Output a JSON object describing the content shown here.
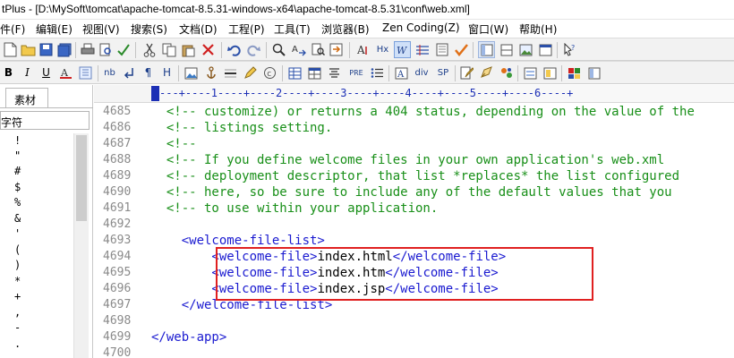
{
  "window": {
    "title": "tPlus - [D:\\MySoft\\tomcat\\apache-tomcat-8.5.31-windows-x64\\apache-tomcat-8.5.31\\conf\\web.xml]"
  },
  "menu": [
    {
      "label": "件(F)"
    },
    {
      "label": "编辑(E)"
    },
    {
      "label": "视图(V)"
    },
    {
      "label": "搜索(S)"
    },
    {
      "label": "文档(D)"
    },
    {
      "label": "工程(P)"
    },
    {
      "label": "工具(T)"
    },
    {
      "label": "浏览器(B)"
    },
    {
      "label": "Zen Coding(Z)"
    },
    {
      "label": "窗口(W)"
    },
    {
      "label": "帮助(H)"
    }
  ],
  "toolbar2_text": {
    "bold": "B",
    "italic": "I",
    "underline": "U",
    "nb": "nb",
    "pilcrow": "¶",
    "h_text": "H",
    "pre": "PRE",
    "div": "div",
    "sp": "SP",
    "hx": "Hx"
  },
  "left_panel": {
    "tab_label": "素材",
    "select_value": "字符",
    "characters": [
      "!",
      "\"",
      "#",
      "$",
      "%",
      "&",
      "'",
      "(",
      ")",
      "*",
      "+",
      ",",
      "-",
      "."
    ]
  },
  "ruler": {
    "text": "---+----1----+----2----+----3----+----4----+----5----+----6----+"
  },
  "editor": {
    "lines": [
      {
        "num": "4685",
        "segments": [
          {
            "cls": "c",
            "text": "  <!-- customize) or returns a 404 status, depending on the value of the"
          }
        ]
      },
      {
        "num": "4686",
        "segments": [
          {
            "cls": "c",
            "text": "  <!-- listings setting."
          }
        ]
      },
      {
        "num": "4687",
        "segments": [
          {
            "cls": "c",
            "text": "  <!--"
          }
        ]
      },
      {
        "num": "4688",
        "segments": [
          {
            "cls": "c",
            "text": "  <!-- If you define welcome files in your own application's web.xml"
          }
        ]
      },
      {
        "num": "4689",
        "segments": [
          {
            "cls": "c",
            "text": "  <!-- deployment descriptor, that list *replaces* the list configured"
          }
        ]
      },
      {
        "num": "4690",
        "segments": [
          {
            "cls": "c",
            "text": "  <!-- here, so be sure to include any of the default values that you"
          }
        ]
      },
      {
        "num": "4691",
        "segments": [
          {
            "cls": "c",
            "text": "  <!-- to use within your application."
          }
        ]
      },
      {
        "num": "4692",
        "segments": []
      },
      {
        "num": "4693",
        "segments": [
          {
            "cls": "t",
            "text": "    <welcome-file-list>"
          }
        ]
      },
      {
        "num": "4694",
        "segments": [
          {
            "cls": "t",
            "text": "        <welcome-file>"
          },
          {
            "cls": "x",
            "text": "index.html"
          },
          {
            "cls": "t",
            "text": "</welcome-file>"
          }
        ]
      },
      {
        "num": "4695",
        "segments": [
          {
            "cls": "t",
            "text": "        <welcome-file>"
          },
          {
            "cls": "x",
            "text": "index.htm"
          },
          {
            "cls": "t",
            "text": "</welcome-file>"
          }
        ]
      },
      {
        "num": "4696",
        "segments": [
          {
            "cls": "t",
            "text": "        <welcome-file>"
          },
          {
            "cls": "x",
            "text": "index.jsp"
          },
          {
            "cls": "t",
            "text": "</welcome-file>"
          }
        ]
      },
      {
        "num": "4697",
        "segments": [
          {
            "cls": "t",
            "text": "    </welcome-file-list>"
          }
        ]
      },
      {
        "num": "4698",
        "segments": []
      },
      {
        "num": "4699",
        "segments": [
          {
            "cls": "t",
            "text": "</web-app>"
          }
        ]
      },
      {
        "num": "4700",
        "segments": []
      }
    ]
  },
  "colors": {
    "comment": "#188f18",
    "tag": "#1a1ad0",
    "text": "#000000",
    "line_number": "#8a8a8a",
    "highlight_border": "#e02020",
    "ruler": "#1c2fb5"
  }
}
